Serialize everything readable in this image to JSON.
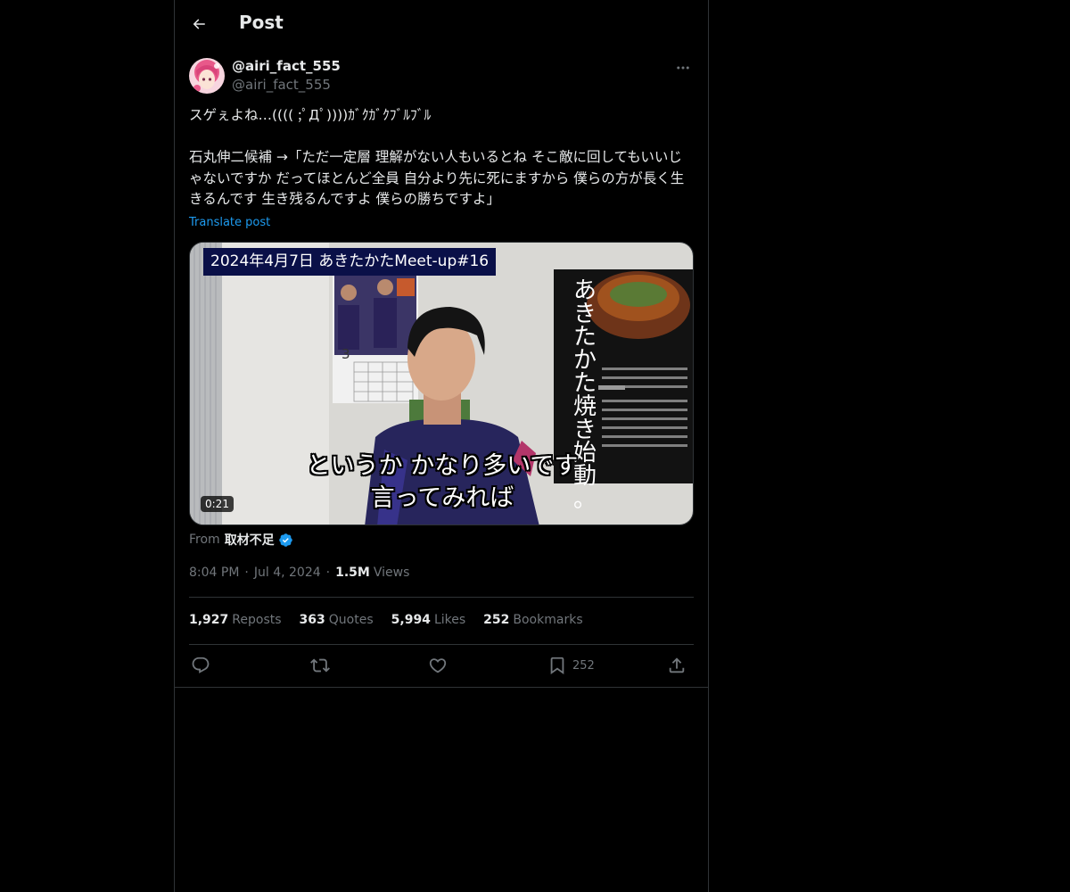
{
  "header": {
    "title": "Post",
    "back_icon": "arrow-left-icon"
  },
  "author": {
    "display_name": "@airi_fact_555",
    "handle": "@airi_fact_555",
    "avatar_icon": "avatar-anime-girl",
    "more_icon": "more-horizontal-icon"
  },
  "post": {
    "text_line1": "スゲぇよね…(((( ;ﾟДﾟ))))ｶﾞｸｶﾞｸﾌﾞﾙﾌﾞﾙ",
    "text_body": "石丸伸二候補 →「ただ一定層 理解がない人もいるとね そこ敵に回してもいいじゃないですか だってほとんど全員 自分より先に死にますから 僕らの方が長く生きるんです 生き残るんですよ 僕らの勝ちですよ」",
    "translate_label": "Translate post"
  },
  "video": {
    "banner_text": "2024年4月7日 あきたかたMeet-up#16",
    "subtitle_line1": "というか かなり多いです",
    "subtitle_line2": "言ってみれば",
    "duration": "0:21",
    "poster_text": "あきたかた焼き始動。",
    "poster_calendar_number": "3"
  },
  "source": {
    "from_label": "From",
    "account_name": "取材不足",
    "verified_icon": "verified-badge-icon",
    "verified_color": "#1d9bf0"
  },
  "meta": {
    "time": "8:04 PM",
    "separator": "·",
    "date": "Jul 4, 2024",
    "views_count": "1.5M",
    "views_label": "Views"
  },
  "stats": [
    {
      "count": "1,927",
      "label": "Reposts"
    },
    {
      "count": "363",
      "label": "Quotes"
    },
    {
      "count": "5,994",
      "label": "Likes"
    },
    {
      "count": "252",
      "label": "Bookmarks"
    }
  ],
  "actions": {
    "reply_icon": "reply-icon",
    "repost_icon": "repost-icon",
    "like_icon": "heart-icon",
    "bookmark_icon": "bookmark-icon",
    "bookmark_count": "252",
    "share_icon": "share-icon"
  },
  "colors": {
    "background": "#000000",
    "text_primary": "#e7e9ea",
    "text_secondary": "#71767b",
    "accent": "#1d9bf0",
    "border": "#2f3336"
  }
}
